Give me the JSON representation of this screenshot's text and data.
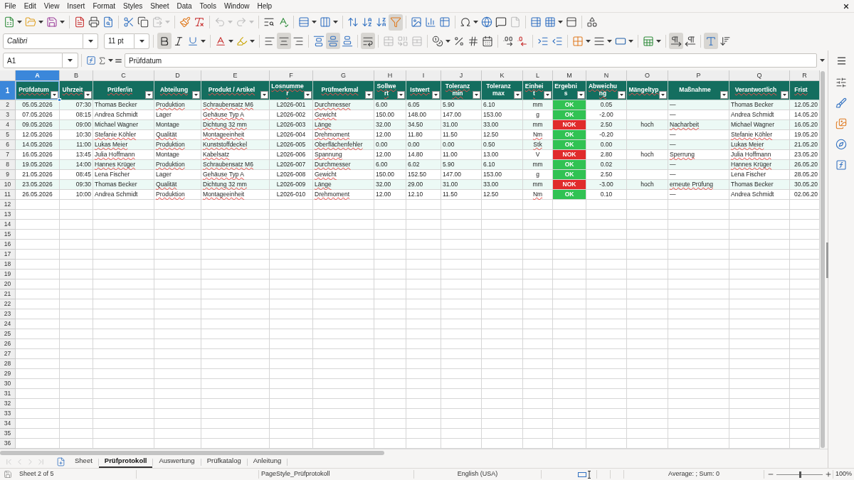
{
  "menu_bar": {
    "items": [
      "File",
      "Edit",
      "View",
      "Insert",
      "Format",
      "Styles",
      "Sheet",
      "Data",
      "Tools",
      "Window",
      "Help"
    ]
  },
  "standard_toolbar": {
    "groups": [
      [
        {
          "on": false,
          "disabled": false,
          "menu": true
        },
        {
          "on": false,
          "disabled": false,
          "menu": true
        },
        {
          "on": false,
          "disabled": false,
          "menu": true
        }
      ],
      [
        {
          "on": false,
          "disabled": false,
          "menu": false
        },
        {
          "on": false,
          "disabled": false,
          "menu": false
        },
        {
          "on": false,
          "disabled": false,
          "menu": false
        }
      ],
      [
        {
          "on": false,
          "disabled": false,
          "menu": false
        },
        {
          "on": false,
          "disabled": false,
          "menu": false
        },
        {
          "on": false,
          "disabled": true,
          "menu": true
        }
      ],
      [
        {
          "on": false,
          "disabled": false,
          "menu": false
        },
        {
          "on": false,
          "disabled": false,
          "menu": false
        }
      ],
      [
        {
          "on": false,
          "disabled": true,
          "menu": true
        },
        {
          "on": false,
          "disabled": true,
          "menu": true
        }
      ],
      [
        {
          "on": false,
          "disabled": false,
          "menu": false
        },
        {
          "on": false,
          "disabled": false,
          "menu": false
        }
      ],
      [
        {
          "on": false,
          "disabled": false,
          "menu": true
        },
        {
          "on": false,
          "disabled": false,
          "menu": true
        }
      ],
      [
        {
          "on": false,
          "disabled": false,
          "menu": false
        },
        {
          "on": false,
          "disabled": false,
          "menu": false
        },
        {
          "on": false,
          "disabled": false,
          "menu": false
        },
        {
          "on": true,
          "disabled": false,
          "menu": false
        }
      ],
      [
        {
          "on": false,
          "disabled": false,
          "menu": false
        },
        {
          "on": false,
          "disabled": false,
          "menu": false
        },
        {
          "on": false,
          "disabled": false,
          "menu": false
        }
      ],
      [
        {
          "on": false,
          "disabled": false,
          "menu": true
        },
        {
          "on": false,
          "disabled": false,
          "menu": false
        },
        {
          "on": false,
          "disabled": false,
          "menu": false
        },
        {
          "on": false,
          "disabled": true,
          "menu": false
        }
      ],
      [
        {
          "on": false,
          "disabled": false,
          "menu": false
        },
        {
          "on": false,
          "disabled": false,
          "menu": true
        },
        {
          "on": false,
          "disabled": false,
          "menu": false
        }
      ],
      [
        {
          "on": false,
          "disabled": false,
          "menu": false
        }
      ]
    ]
  },
  "formatting_toolbar": {
    "font_name": "Calibri",
    "font_size": "11 pt",
    "groups": [
      [
        {
          "on": true,
          "disabled": false,
          "menu": false
        },
        {
          "on": false,
          "disabled": false,
          "menu": false
        },
        {
          "on": false,
          "disabled": false,
          "menu": true
        }
      ],
      [
        {
          "on": false,
          "disabled": false,
          "menu": true
        },
        {
          "on": false,
          "disabled": false,
          "menu": true
        }
      ],
      [
        {
          "on": false,
          "disabled": false,
          "menu": false
        },
        {
          "on": true,
          "disabled": false,
          "menu": false
        },
        {
          "on": false,
          "disabled": false,
          "menu": false
        }
      ],
      [
        {
          "on": false,
          "disabled": false,
          "menu": false
        },
        {
          "on": true,
          "disabled": false,
          "menu": false
        },
        {
          "on": false,
          "disabled": false,
          "menu": false
        }
      ],
      [
        {
          "on": true,
          "disabled": false,
          "menu": false
        }
      ],
      [
        {
          "on": false,
          "disabled": true,
          "menu": false
        },
        {
          "on": false,
          "disabled": true,
          "menu": false
        },
        {
          "on": false,
          "disabled": true,
          "menu": false
        }
      ],
      [
        {
          "on": false,
          "disabled": false,
          "menu": true
        },
        {
          "on": false,
          "disabled": false,
          "menu": false
        },
        {
          "on": false,
          "disabled": false,
          "menu": false
        },
        {
          "on": false,
          "disabled": false,
          "menu": false
        }
      ],
      [
        {
          "on": false,
          "disabled": false,
          "menu": false
        },
        {
          "on": false,
          "disabled": false,
          "menu": false
        }
      ],
      [
        {
          "on": false,
          "disabled": false,
          "menu": false
        },
        {
          "on": false,
          "disabled": false,
          "menu": false
        }
      ],
      [
        {
          "on": false,
          "disabled": false,
          "menu": true
        },
        {
          "on": false,
          "disabled": false,
          "menu": true
        },
        {
          "on": false,
          "disabled": false,
          "menu": true
        }
      ],
      [
        {
          "on": false,
          "disabled": false,
          "menu": true
        }
      ],
      [
        {
          "on": true,
          "disabled": false,
          "menu": false
        },
        {
          "on": false,
          "disabled": false,
          "menu": false
        }
      ],
      [
        {
          "on": true,
          "disabled": false,
          "menu": false
        },
        {
          "on": false,
          "disabled": false,
          "menu": false
        }
      ]
    ]
  },
  "formula_bar": {
    "name_box": "A1",
    "content": "Prüfdatum"
  },
  "sheet": {
    "columns": [
      {
        "label": "A",
        "selected": true
      },
      {
        "label": "B",
        "selected": false
      },
      {
        "label": "C",
        "selected": false
      },
      {
        "label": "D",
        "selected": false
      },
      {
        "label": "E",
        "selected": false
      },
      {
        "label": "F",
        "selected": false
      },
      {
        "label": "G",
        "selected": false
      },
      {
        "label": "H",
        "selected": false
      },
      {
        "label": "I",
        "selected": false
      },
      {
        "label": "J",
        "selected": false
      },
      {
        "label": "K",
        "selected": false
      },
      {
        "label": "L",
        "selected": false
      },
      {
        "label": "M",
        "selected": false
      },
      {
        "label": "N",
        "selected": false
      },
      {
        "label": "O",
        "selected": false
      },
      {
        "label": "P",
        "selected": false
      },
      {
        "label": "Q",
        "selected": false
      },
      {
        "label": "R",
        "selected": false
      }
    ],
    "header_row": {
      "number": "1",
      "selected": true,
      "cells": [
        {
          "text": "Prüfdatum",
          "spell_error": true,
          "filter": true
        },
        {
          "text": "Uhrzeit",
          "spell_error": true,
          "filter": true
        },
        {
          "text": "Prüfer/in",
          "spell_error": true,
          "filter": true
        },
        {
          "text": "Abteilung",
          "spell_error": true,
          "filter": true
        },
        {
          "text": "Produkt / Artikel",
          "spell_error": true,
          "filter": true
        },
        {
          "text": "Losnummer",
          "spell_error": true,
          "filter": true
        },
        {
          "text": "Prüfmerkmal",
          "spell_error": true,
          "filter": true
        },
        {
          "text": "Sollwert",
          "spell_error": true,
          "filter": true
        },
        {
          "text": "Istwert",
          "spell_error": true,
          "filter": true
        },
        {
          "text": "Toleranz min",
          "spell_error": true,
          "filter": true
        },
        {
          "text": "Toleranz max",
          "spell_error": false,
          "filter": true
        },
        {
          "text": "Einheit",
          "spell_error": true,
          "filter": true
        },
        {
          "text": "Ergebnis",
          "spell_error": false,
          "filter": true
        },
        {
          "text": "Abweichung",
          "spell_error": true,
          "filter": true
        },
        {
          "text": "Mängeltyp",
          "spell_error": true,
          "filter": true
        },
        {
          "text": "Maßnahme",
          "spell_error": false,
          "filter": true
        },
        {
          "text": "Verantwortlich",
          "spell_error": true,
          "filter": true
        },
        {
          "text": "Frist",
          "spell_error": true,
          "filter": false
        }
      ]
    },
    "rows": [
      {
        "number": "2",
        "selected": false,
        "cells": [
          {
            "text": "05.05.2026",
            "spell_error": false
          },
          {
            "text": "07:30",
            "spell_error": false
          },
          {
            "text": "Thomas Becker",
            "spell_error": false
          },
          {
            "text": "Produktion",
            "spell_error": true
          },
          {
            "text": "Schraubensatz M6",
            "spell_error": true
          },
          {
            "text": "L2026-001",
            "spell_error": false
          },
          {
            "text": "Durchmesser",
            "spell_error": true
          },
          {
            "text": "6.00",
            "spell_error": false
          },
          {
            "text": "6.05",
            "spell_error": false
          },
          {
            "text": "5.90",
            "spell_error": false
          },
          {
            "text": "6.10",
            "spell_error": false
          },
          {
            "text": "mm",
            "spell_error": false
          },
          {
            "text": "OK",
            "spell_error": false,
            "color": "#31c253"
          },
          {
            "text": "0.05",
            "spell_error": false
          },
          null,
          {
            "text": "—",
            "spell_error": false
          },
          {
            "text": "Thomas Becker",
            "spell_error": false
          },
          {
            "text": "12.05.20",
            "spell_error": false
          }
        ]
      },
      {
        "number": "3",
        "selected": false,
        "cells": [
          {
            "text": "07.05.2026",
            "spell_error": false
          },
          {
            "text": "08:15",
            "spell_error": false
          },
          {
            "text": "Andrea Schmidt",
            "spell_error": false
          },
          {
            "text": "Lager",
            "spell_error": false
          },
          {
            "text": "Gehäuse Typ A",
            "spell_error": true
          },
          {
            "text": "L2026-002",
            "spell_error": false
          },
          {
            "text": "Gewicht",
            "spell_error": true
          },
          {
            "text": "150.00",
            "spell_error": false
          },
          {
            "text": "148.00",
            "spell_error": false
          },
          {
            "text": "147.00",
            "spell_error": false
          },
          {
            "text": "153.00",
            "spell_error": false
          },
          {
            "text": "g",
            "spell_error": false
          },
          {
            "text": "OK",
            "spell_error": false,
            "color": "#31c253"
          },
          {
            "text": "-2.00",
            "spell_error": false
          },
          null,
          {
            "text": "—",
            "spell_error": false
          },
          {
            "text": "Andrea Schmidt",
            "spell_error": false
          },
          {
            "text": "14.05.20",
            "spell_error": false
          }
        ]
      },
      {
        "number": "4",
        "selected": false,
        "cells": [
          {
            "text": "09.05.2026",
            "spell_error": false
          },
          {
            "text": "09:00",
            "spell_error": false
          },
          {
            "text": "Michael Wagner",
            "spell_error": false
          },
          {
            "text": "Montage",
            "spell_error": false
          },
          {
            "text": "Dichtung 32 mm",
            "spell_error": true
          },
          {
            "text": "L2026-003",
            "spell_error": false
          },
          {
            "text": "Länge",
            "spell_error": true
          },
          {
            "text": "32.00",
            "spell_error": false
          },
          {
            "text": "34.50",
            "spell_error": false
          },
          {
            "text": "31.00",
            "spell_error": false
          },
          {
            "text": "33.00",
            "spell_error": false
          },
          {
            "text": "mm",
            "spell_error": false
          },
          {
            "text": "NOK",
            "spell_error": false,
            "color": "#e02b2b"
          },
          {
            "text": "2.50",
            "spell_error": false
          },
          {
            "text": "hoch",
            "spell_error": false
          },
          {
            "text": "Nacharbeit",
            "spell_error": true
          },
          {
            "text": "Michael Wagner",
            "spell_error": false
          },
          {
            "text": "16.05.20",
            "spell_error": false
          }
        ]
      },
      {
        "number": "5",
        "selected": false,
        "cells": [
          {
            "text": "12.05.2026",
            "spell_error": false
          },
          {
            "text": "10:30",
            "spell_error": false
          },
          {
            "text": "Stefanie Köhler",
            "spell_error": true
          },
          {
            "text": "Qualität",
            "spell_error": true
          },
          {
            "text": "Montageeinheit",
            "spell_error": true
          },
          {
            "text": "L2026-004",
            "spell_error": false
          },
          {
            "text": "Drehmoment",
            "spell_error": true
          },
          {
            "text": "12.00",
            "spell_error": false
          },
          {
            "text": "11.80",
            "spell_error": false
          },
          {
            "text": "11.50",
            "spell_error": false
          },
          {
            "text": "12.50",
            "spell_error": false
          },
          {
            "text": "Nm",
            "spell_error": true
          },
          {
            "text": "OK",
            "spell_error": false,
            "color": "#31c253"
          },
          {
            "text": "-0.20",
            "spell_error": false
          },
          null,
          {
            "text": "—",
            "spell_error": false
          },
          {
            "text": "Stefanie Köhler",
            "spell_error": true
          },
          {
            "text": "19.05.20",
            "spell_error": false
          }
        ]
      },
      {
        "number": "6",
        "selected": false,
        "cells": [
          {
            "text": "14.05.2026",
            "spell_error": false
          },
          {
            "text": "11:00",
            "spell_error": false
          },
          {
            "text": "Lukas Meier",
            "spell_error": true
          },
          {
            "text": "Produktion",
            "spell_error": true
          },
          {
            "text": "Kunststoffdeckel",
            "spell_error": true
          },
          {
            "text": "L2026-005",
            "spell_error": false
          },
          {
            "text": "Oberflächenfehler",
            "spell_error": true
          },
          {
            "text": "0.00",
            "spell_error": false
          },
          {
            "text": "0.00",
            "spell_error": false
          },
          {
            "text": "0.00",
            "spell_error": false
          },
          {
            "text": "0.50",
            "spell_error": false
          },
          {
            "text": "Stk",
            "spell_error": true
          },
          {
            "text": "OK",
            "spell_error": false,
            "color": "#31c253"
          },
          {
            "text": "0.00",
            "spell_error": false
          },
          null,
          {
            "text": "—",
            "spell_error": false
          },
          {
            "text": "Lukas Meier",
            "spell_error": true
          },
          {
            "text": "21.05.20",
            "spell_error": false
          }
        ]
      },
      {
        "number": "7",
        "selected": false,
        "cells": [
          {
            "text": "16.05.2026",
            "spell_error": false
          },
          {
            "text": "13:45",
            "spell_error": false
          },
          {
            "text": "Julia Hoffmann",
            "spell_error": true
          },
          {
            "text": "Montage",
            "spell_error": false
          },
          {
            "text": "Kabelsatz",
            "spell_error": true
          },
          {
            "text": "L2026-006",
            "spell_error": false
          },
          {
            "text": "Spannung",
            "spell_error": true
          },
          {
            "text": "12.00",
            "spell_error": false
          },
          {
            "text": "14.80",
            "spell_error": false
          },
          {
            "text": "11.00",
            "spell_error": false
          },
          {
            "text": "13.00",
            "spell_error": false
          },
          {
            "text": "V",
            "spell_error": false
          },
          {
            "text": "NOK",
            "spell_error": false,
            "color": "#e02b2b"
          },
          {
            "text": "2.80",
            "spell_error": false
          },
          {
            "text": "hoch",
            "spell_error": false
          },
          {
            "text": "Sperrung",
            "spell_error": true
          },
          {
            "text": "Julia Hoffmann",
            "spell_error": true
          },
          {
            "text": "23.05.20",
            "spell_error": false
          }
        ]
      },
      {
        "number": "8",
        "selected": false,
        "cells": [
          {
            "text": "19.05.2026",
            "spell_error": false
          },
          {
            "text": "14:00",
            "spell_error": false
          },
          {
            "text": "Hannes Krüger",
            "spell_error": true
          },
          {
            "text": "Produktion",
            "spell_error": true
          },
          {
            "text": "Schraubensatz M6",
            "spell_error": true
          },
          {
            "text": "L2026-007",
            "spell_error": false
          },
          {
            "text": "Durchmesser",
            "spell_error": true
          },
          {
            "text": "6.00",
            "spell_error": false
          },
          {
            "text": "6.02",
            "spell_error": false
          },
          {
            "text": "5.90",
            "spell_error": false
          },
          {
            "text": "6.10",
            "spell_error": false
          },
          {
            "text": "mm",
            "spell_error": false
          },
          {
            "text": "OK",
            "spell_error": false,
            "color": "#31c253"
          },
          {
            "text": "0.02",
            "spell_error": false
          },
          null,
          {
            "text": "—",
            "spell_error": false
          },
          {
            "text": "Hannes Krüger",
            "spell_error": true
          },
          {
            "text": "26.05.20",
            "spell_error": false
          }
        ]
      },
      {
        "number": "9",
        "selected": false,
        "cells": [
          {
            "text": "21.05.2026",
            "spell_error": false
          },
          {
            "text": "08:45",
            "spell_error": false
          },
          {
            "text": "Lena Fischer",
            "spell_error": false
          },
          {
            "text": "Lager",
            "spell_error": false
          },
          {
            "text": "Gehäuse Typ A",
            "spell_error": true
          },
          {
            "text": "L2026-008",
            "spell_error": false
          },
          {
            "text": "Gewicht",
            "spell_error": true
          },
          {
            "text": "150.00",
            "spell_error": false
          },
          {
            "text": "152.50",
            "spell_error": false
          },
          {
            "text": "147.00",
            "spell_error": false
          },
          {
            "text": "153.00",
            "spell_error": false
          },
          {
            "text": "g",
            "spell_error": false
          },
          {
            "text": "OK",
            "spell_error": false,
            "color": "#31c253"
          },
          {
            "text": "2.50",
            "spell_error": false
          },
          null,
          {
            "text": "—",
            "spell_error": false
          },
          {
            "text": "Lena Fischer",
            "spell_error": false
          },
          {
            "text": "28.05.20",
            "spell_error": false
          }
        ]
      },
      {
        "number": "10",
        "selected": false,
        "cells": [
          {
            "text": "23.05.2026",
            "spell_error": false
          },
          {
            "text": "09:30",
            "spell_error": false
          },
          {
            "text": "Thomas Becker",
            "spell_error": false
          },
          {
            "text": "Qualität",
            "spell_error": true
          },
          {
            "text": "Dichtung 32 mm",
            "spell_error": true
          },
          {
            "text": "L2026-009",
            "spell_error": false
          },
          {
            "text": "Länge",
            "spell_error": true
          },
          {
            "text": "32.00",
            "spell_error": false
          },
          {
            "text": "29.00",
            "spell_error": false
          },
          {
            "text": "31.00",
            "spell_error": false
          },
          {
            "text": "33.00",
            "spell_error": false
          },
          {
            "text": "mm",
            "spell_error": false
          },
          {
            "text": "NOK",
            "spell_error": false,
            "color": "#e02b2b"
          },
          {
            "text": "-3.00",
            "spell_error": false
          },
          {
            "text": "hoch",
            "spell_error": false
          },
          {
            "text": "erneute Prüfung",
            "spell_error": true
          },
          {
            "text": "Thomas Becker",
            "spell_error": false
          },
          {
            "text": "30.05.20",
            "spell_error": false
          }
        ]
      },
      {
        "number": "11",
        "selected": false,
        "cells": [
          {
            "text": "26.05.2026",
            "spell_error": false
          },
          {
            "text": "10:00",
            "spell_error": false
          },
          {
            "text": "Andrea Schmidt",
            "spell_error": false
          },
          {
            "text": "Produktion",
            "spell_error": true
          },
          {
            "text": "Montageeinheit",
            "spell_error": true
          },
          {
            "text": "L2026-010",
            "spell_error": false
          },
          {
            "text": "Drehmoment",
            "spell_error": true
          },
          {
            "text": "12.00",
            "spell_error": false
          },
          {
            "text": "12.10",
            "spell_error": false
          },
          {
            "text": "11.50",
            "spell_error": false
          },
          {
            "text": "12.50",
            "spell_error": false
          },
          {
            "text": "Nm",
            "spell_error": true
          },
          {
            "text": "OK",
            "spell_error": false,
            "color": "#31c253"
          },
          {
            "text": "0.10",
            "spell_error": false
          },
          null,
          {
            "text": "—",
            "spell_error": false
          },
          {
            "text": "Andrea Schmidt",
            "spell_error": false
          },
          {
            "text": "02.06.20",
            "spell_error": false
          }
        ]
      }
    ],
    "empty_rows": [
      {
        "number": "12",
        "selected": false
      },
      {
        "number": "13",
        "selected": false
      },
      {
        "number": "14",
        "selected": false
      },
      {
        "number": "15",
        "selected": false
      },
      {
        "number": "16",
        "selected": false
      },
      {
        "number": "17",
        "selected": false
      },
      {
        "number": "18",
        "selected": false
      },
      {
        "number": "19",
        "selected": false
      },
      {
        "number": "20",
        "selected": false
      },
      {
        "number": "21",
        "selected": false
      },
      {
        "number": "22",
        "selected": false
      },
      {
        "number": "23",
        "selected": false
      },
      {
        "number": "24",
        "selected": false
      },
      {
        "number": "25",
        "selected": false
      },
      {
        "number": "26",
        "selected": false
      },
      {
        "number": "27",
        "selected": false
      },
      {
        "number": "28",
        "selected": false
      },
      {
        "number": "29",
        "selected": false
      },
      {
        "number": "30",
        "selected": false
      },
      {
        "number": "31",
        "selected": false
      },
      {
        "number": "32",
        "selected": false
      },
      {
        "number": "33",
        "selected": false
      },
      {
        "number": "34",
        "selected": false
      },
      {
        "number": "35",
        "selected": false
      },
      {
        "number": "36",
        "selected": false
      }
    ]
  },
  "sheet_tabs": {
    "navigation": [
      {
        "disabled": true
      },
      {
        "disabled": true
      },
      {
        "disabled": true
      },
      {
        "disabled": true
      }
    ],
    "tabs": [
      {
        "label": "Sheet",
        "selected": false
      },
      {
        "label": "Prüfprotokoll",
        "selected": true
      },
      {
        "label": "Auswertung",
        "selected": false
      },
      {
        "label": "Prüfkatalog",
        "selected": false
      },
      {
        "label": "Anleitung",
        "selected": false
      }
    ]
  },
  "status_bar": {
    "sheet_position": "Sheet 2 of 5",
    "page_style": "PageStyle_Prüfprotokoll",
    "language": "English (USA)",
    "selection_summary": "Average: ; Sum: 0",
    "zoom": {
      "label": "100%",
      "level": 0.5
    }
  }
}
